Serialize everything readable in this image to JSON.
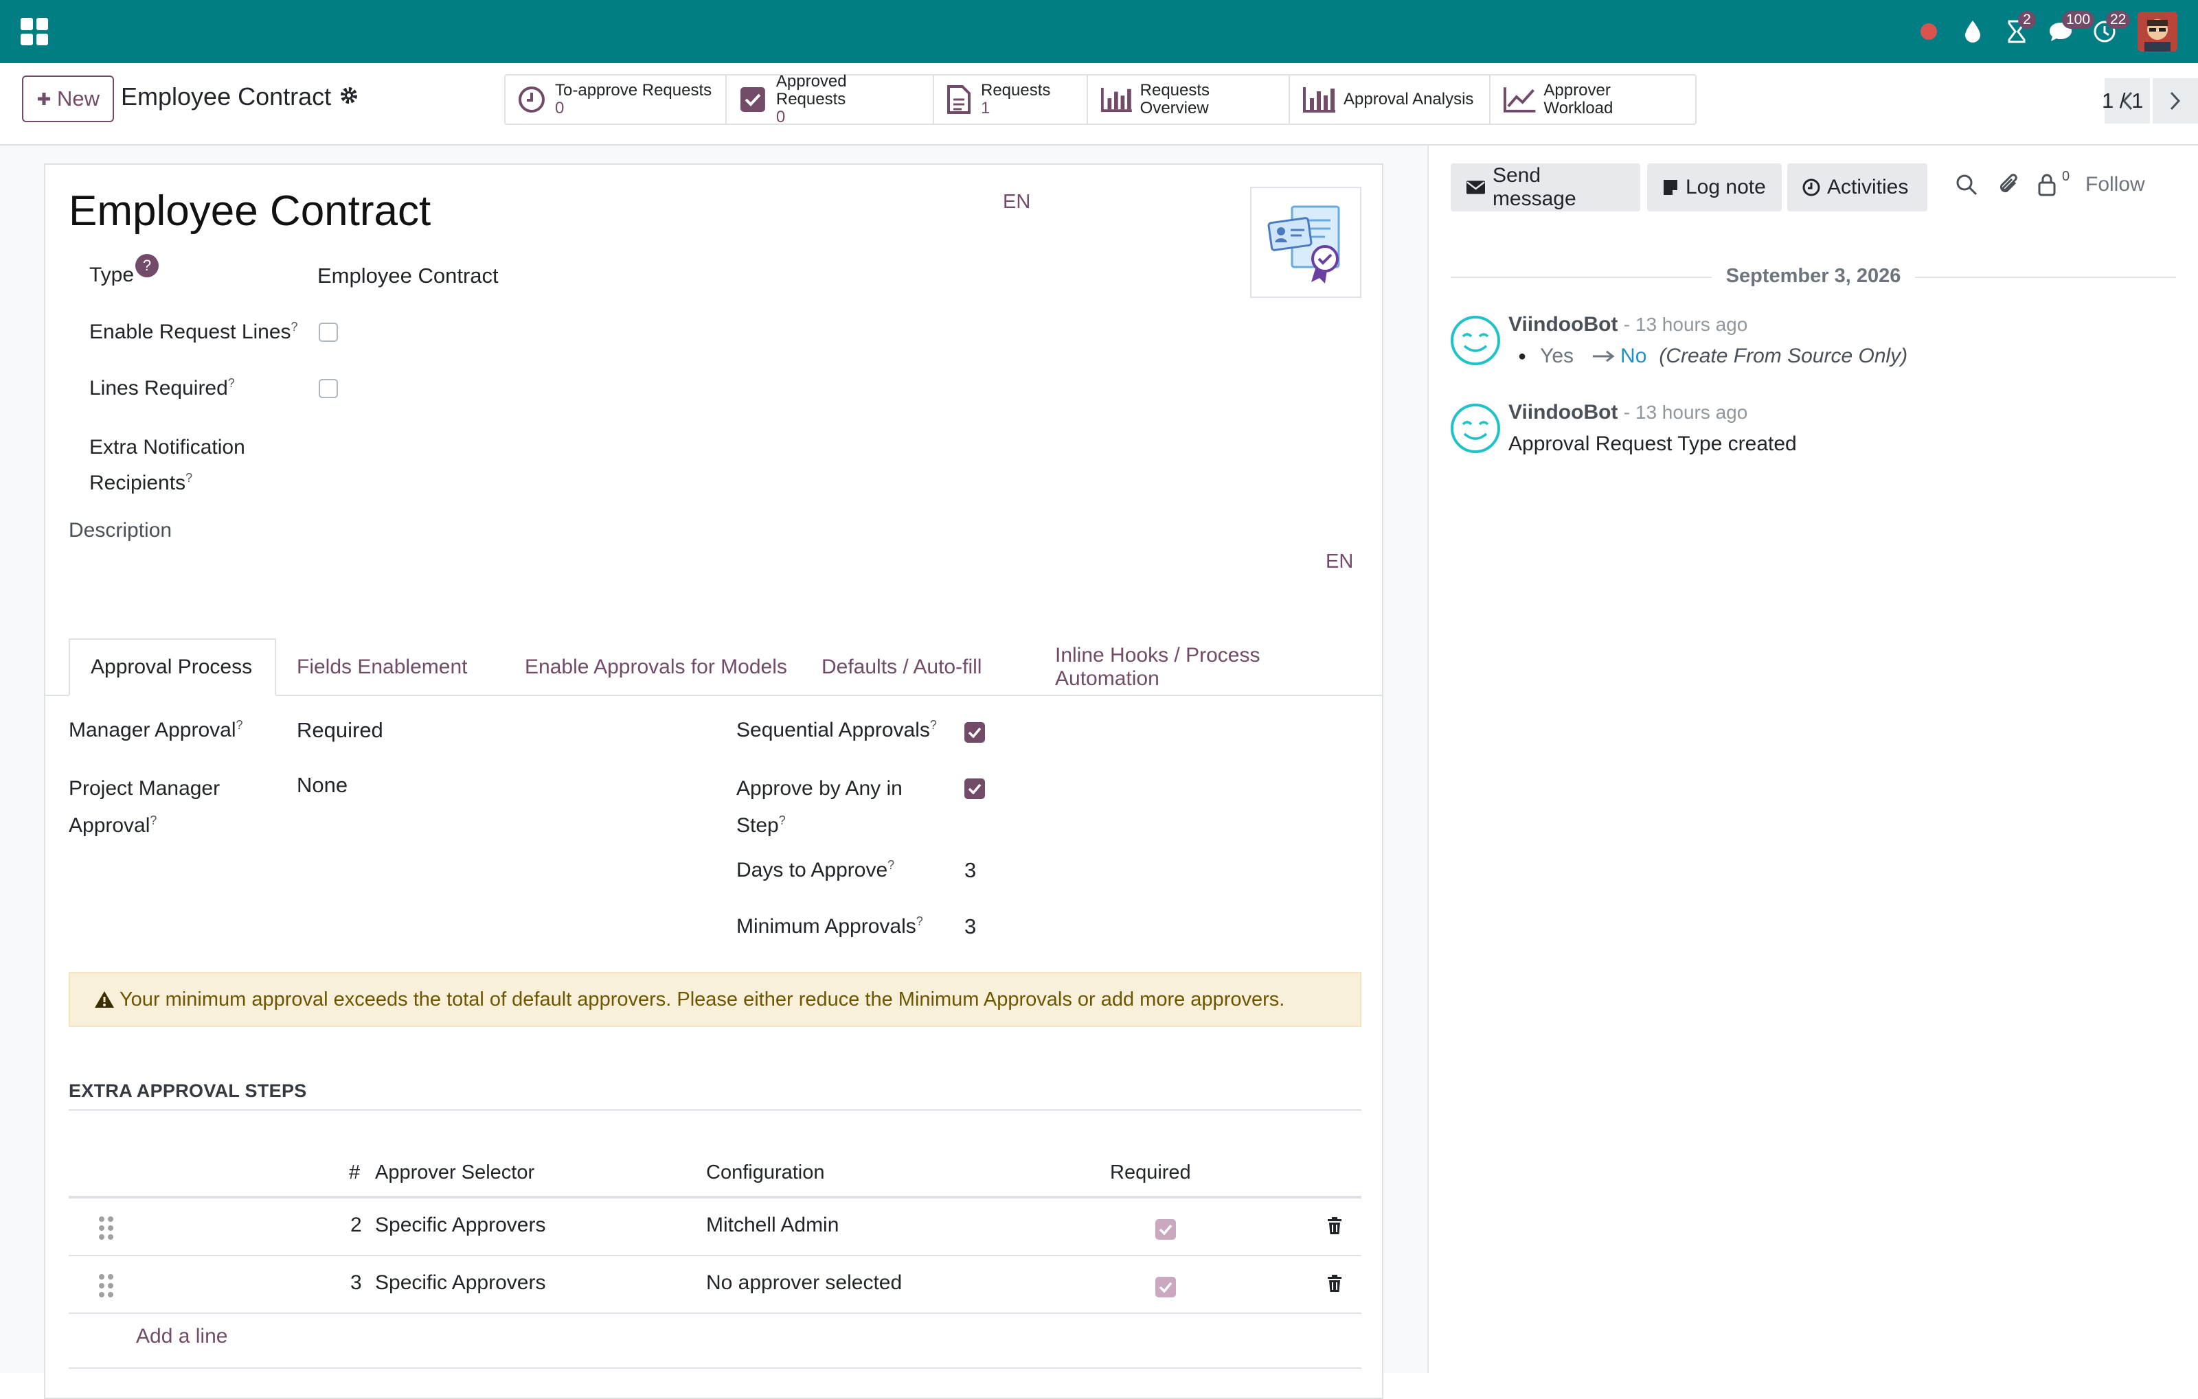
{
  "navbar": {
    "badges": {
      "activities": "2",
      "messages": "100",
      "discuss": "22"
    }
  },
  "control_panel": {
    "new_label": "New",
    "breadcrumb": "Employee Contract",
    "smart_buttons": [
      {
        "title": "To-approve Requests",
        "value": "0",
        "icon": "clock-icon"
      },
      {
        "title": "Approved Requests",
        "value": "0",
        "icon": "checkbox-icon"
      },
      {
        "title": "Requests",
        "value": "1",
        "icon": "document-icon"
      },
      {
        "title": "Requests Overview",
        "icon": "bar-chart-icon"
      },
      {
        "title": "Approval Analysis",
        "icon": "bar-chart-icon"
      },
      {
        "title": "Approver Workload",
        "icon": "area-chart-icon"
      }
    ],
    "pager": "1 / 1"
  },
  "form": {
    "title": "Employee Contract",
    "lang_title": "EN",
    "lang_desc": "EN",
    "fields": {
      "type_label": "Type",
      "type_value": "Employee Contract",
      "type_help": "?",
      "enable_lines_label": "Enable Request Lines",
      "lines_required_label": "Lines Required",
      "extra_notif_label_1": "Extra Notification",
      "extra_notif_label_2": "Recipients",
      "description_label": "Description"
    },
    "tabs": [
      "Approval Process",
      "Fields Enablement",
      "Enable Approvals for Models",
      "Defaults / Auto-fill",
      "Inline Hooks / Process Automation"
    ],
    "approval": {
      "manager_label": "Manager Approval",
      "manager_value": "Required",
      "pm_label_1": "Project Manager",
      "pm_label_2": "Approval",
      "pm_value": "None",
      "sequential_label": "Sequential Approvals",
      "sequential": true,
      "any_label_1": "Approve by Any in",
      "any_label_2": "Step",
      "any": true,
      "days_label": "Days to Approve",
      "days_value": "3",
      "min_label": "Minimum Approvals",
      "min_value": "3"
    },
    "alert": "Your minimum approval exceeds the total of default approvers. Please either reduce the Minimum Approvals or add more approvers.",
    "steps_title": "EXTRA APPROVAL STEPS",
    "steps_table": {
      "headers": [
        "#",
        "Approver Selector",
        "Configuration",
        "Required"
      ],
      "rows": [
        {
          "num": "2",
          "selector": "Specific Approvers",
          "config": "Mitchell Admin",
          "required": true
        },
        {
          "num": "3",
          "selector": "Specific Approvers",
          "config": "No approver selected",
          "required": true
        }
      ],
      "add_line": "Add a line"
    }
  },
  "chatter": {
    "send_message": "Send message",
    "log_note": "Log note",
    "activities": "Activities",
    "follower_count": "0",
    "follow": "Follow",
    "date": "September 3, 2026",
    "messages": [
      {
        "author": "ViindooBot",
        "ago": "- 13 hours ago",
        "old": "Yes",
        "new": "No",
        "field": "(Create From Source Only)"
      },
      {
        "author": "ViindooBot",
        "ago": "- 13 hours ago",
        "text": "Approval Request Type created"
      }
    ]
  }
}
